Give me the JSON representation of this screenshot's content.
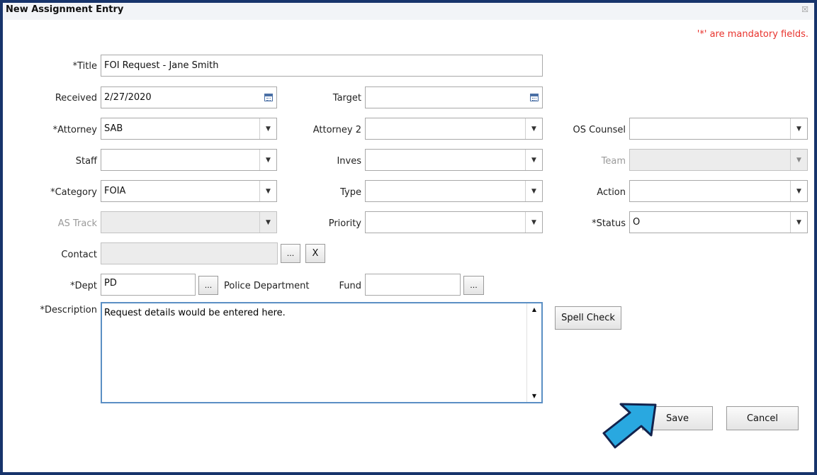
{
  "window": {
    "title": "New Assignment Entry",
    "close_glyph": "☒"
  },
  "notice": "'*' are mandatory fields.",
  "labels": {
    "title": "*Title",
    "received": "Received",
    "target": "Target",
    "attorney": "*Attorney",
    "attorney2": "Attorney 2",
    "os_counsel": "OS Counsel",
    "staff": "Staff",
    "inves": "Inves",
    "team": "Team",
    "category": "*Category",
    "type": "Type",
    "action": "Action",
    "as_track": "AS Track",
    "priority": "Priority",
    "status": "*Status",
    "contact": "Contact",
    "dept": "*Dept",
    "dept_name": "Police Department",
    "fund": "Fund",
    "description": "*Description"
  },
  "values": {
    "title": "FOI Request - Jane Smith",
    "received": "2/27/2020",
    "target": "",
    "attorney": "SAB",
    "attorney2": "",
    "os_counsel": "",
    "staff": "",
    "inves": "",
    "team": "",
    "category": "FOIA",
    "type": "",
    "action": "",
    "as_track": "",
    "priority": "",
    "status": "O",
    "contact": "",
    "dept": "PD",
    "fund": "",
    "description": "Request details would be entered here."
  },
  "buttons": {
    "ellipsis": "...",
    "clear": "X",
    "spell_check": "Spell Check",
    "save": "Save",
    "cancel": "Cancel"
  },
  "icons": {
    "dropdown": "chevron-down-icon",
    "calendar": "calendar-icon",
    "pointer": "blue-arrow-icon"
  },
  "colors": {
    "border": "#17346b",
    "required_note": "#e8332d",
    "arrow_fill": "#29a8e0",
    "arrow_stroke": "#13234d"
  }
}
